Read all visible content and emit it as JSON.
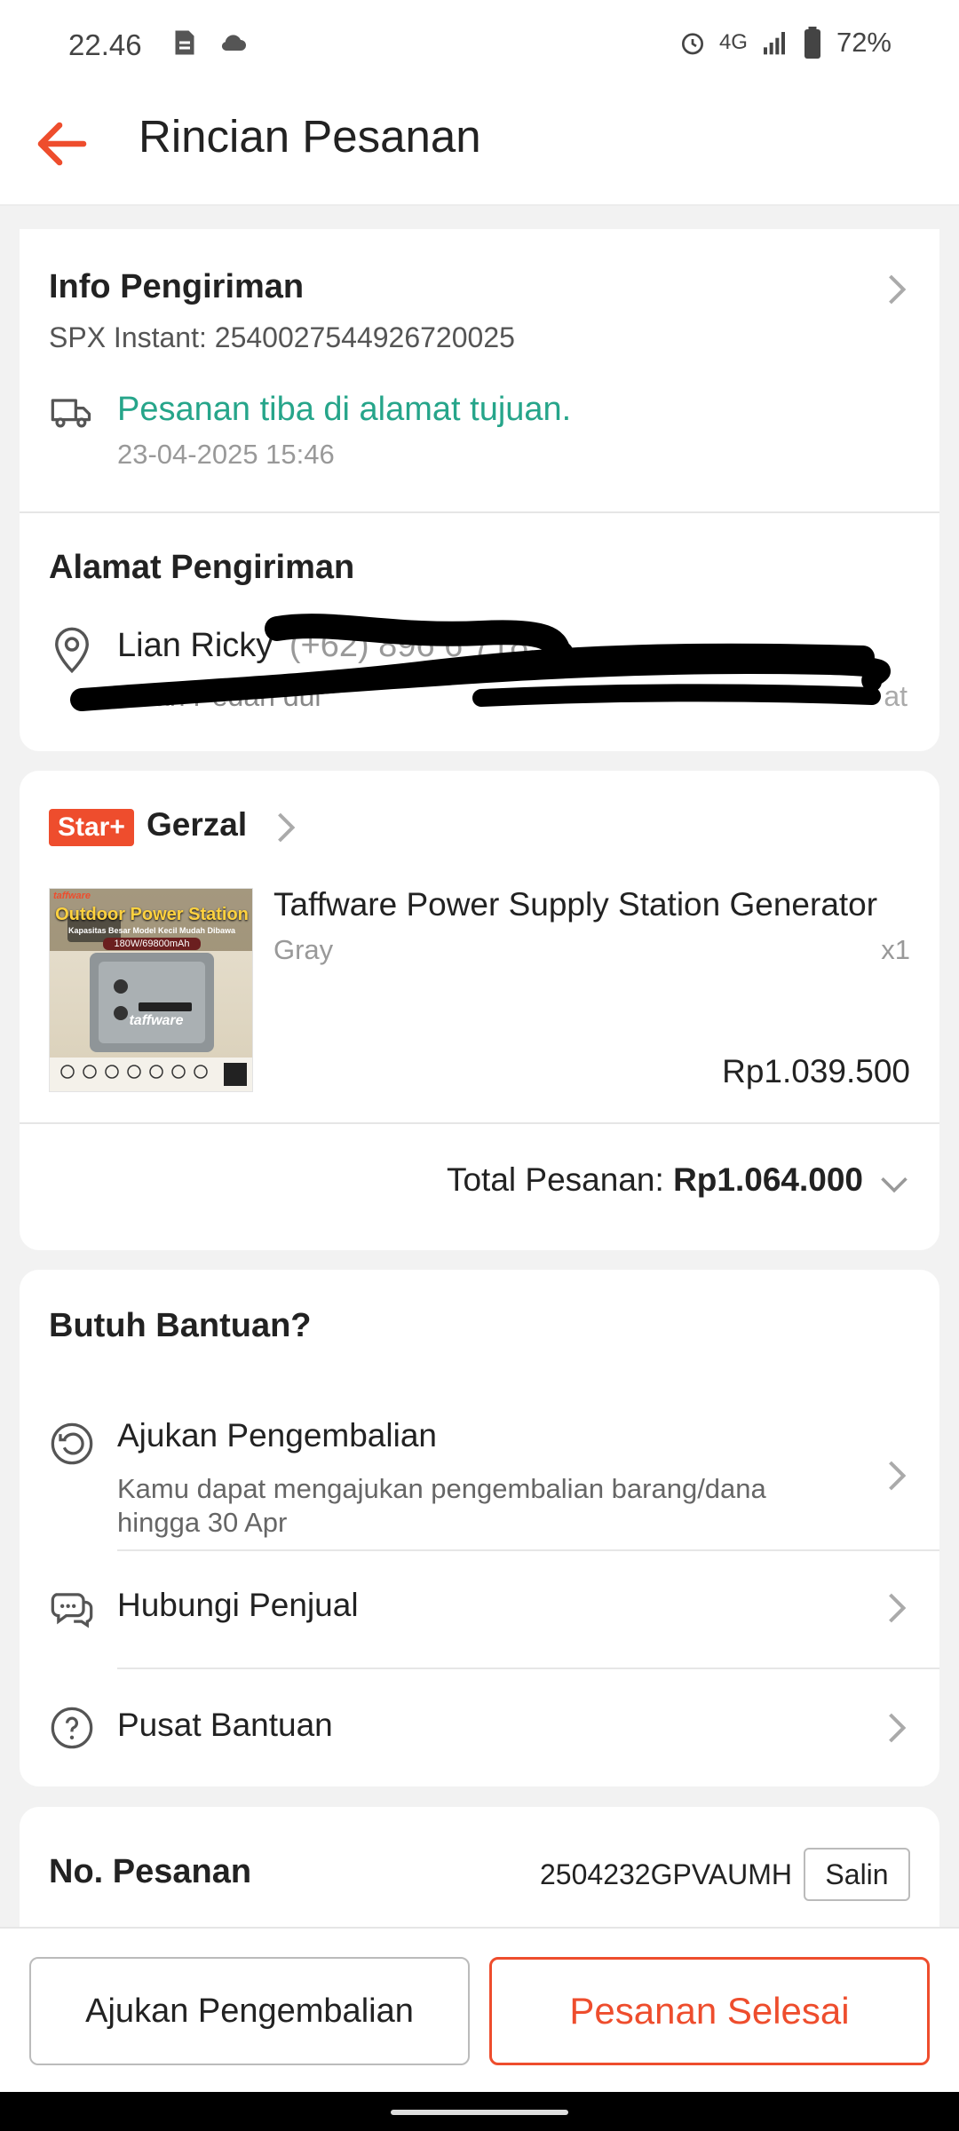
{
  "status_bar": {
    "time": "22.46",
    "network": "4G",
    "battery": "72%",
    "icons": [
      "sd-card-icon",
      "cloud-icon",
      "alarm-icon",
      "signal-icon",
      "battery-icon"
    ]
  },
  "header": {
    "back_icon": "arrow-left-icon",
    "title": "Rincian Pesanan",
    "accent_color": "#ee4d2d"
  },
  "shipping_info": {
    "title": "Info Pengiriman",
    "tracking": "SPX Instant: 2540027544926720025",
    "status": "Pesanan tiba di alamat tujuan.",
    "status_color": "#26a58a",
    "date": "23-04-2025 15:46"
  },
  "address": {
    "title": "Alamat Pengiriman",
    "name_visible": "Lian Ricky",
    "phone_partial": "(+62) 896 6 7183",
    "line_partial": "Jalan Pedan dul",
    "line_end": "at"
  },
  "shop": {
    "badge": "Star+",
    "name": "Gerzal"
  },
  "product": {
    "image_title": "Outdoor Power Station",
    "image_subtitle": "Kapasitas Besar Model Kecil Mudah Dibawa",
    "image_spec": "180W/69800mAh",
    "image_brand": "taffware",
    "name": "Taffware Power Supply Station Generator",
    "variant": "Gray",
    "qty": "x1",
    "price": "Rp1.039.500"
  },
  "order_total": {
    "label": "Total Pesanan:",
    "value": "Rp1.064.000"
  },
  "help": {
    "title": "Butuh Bantuan?",
    "items": [
      {
        "label": "Ajukan Pengembalian",
        "sub": "Kamu dapat mengajukan pengembalian barang/dana hingga 30 Apr",
        "icon": "return-icon"
      },
      {
        "label": "Hubungi Penjual",
        "icon": "chat-icon"
      },
      {
        "label": "Pusat Bantuan",
        "icon": "help-icon"
      }
    ]
  },
  "order_number": {
    "label": "No. Pesanan",
    "value": "2504232GPVAUMH",
    "copy_label": "Salin"
  },
  "actions": {
    "return_label": "Ajukan Pengembalian",
    "complete_label": "Pesanan Selesai"
  }
}
